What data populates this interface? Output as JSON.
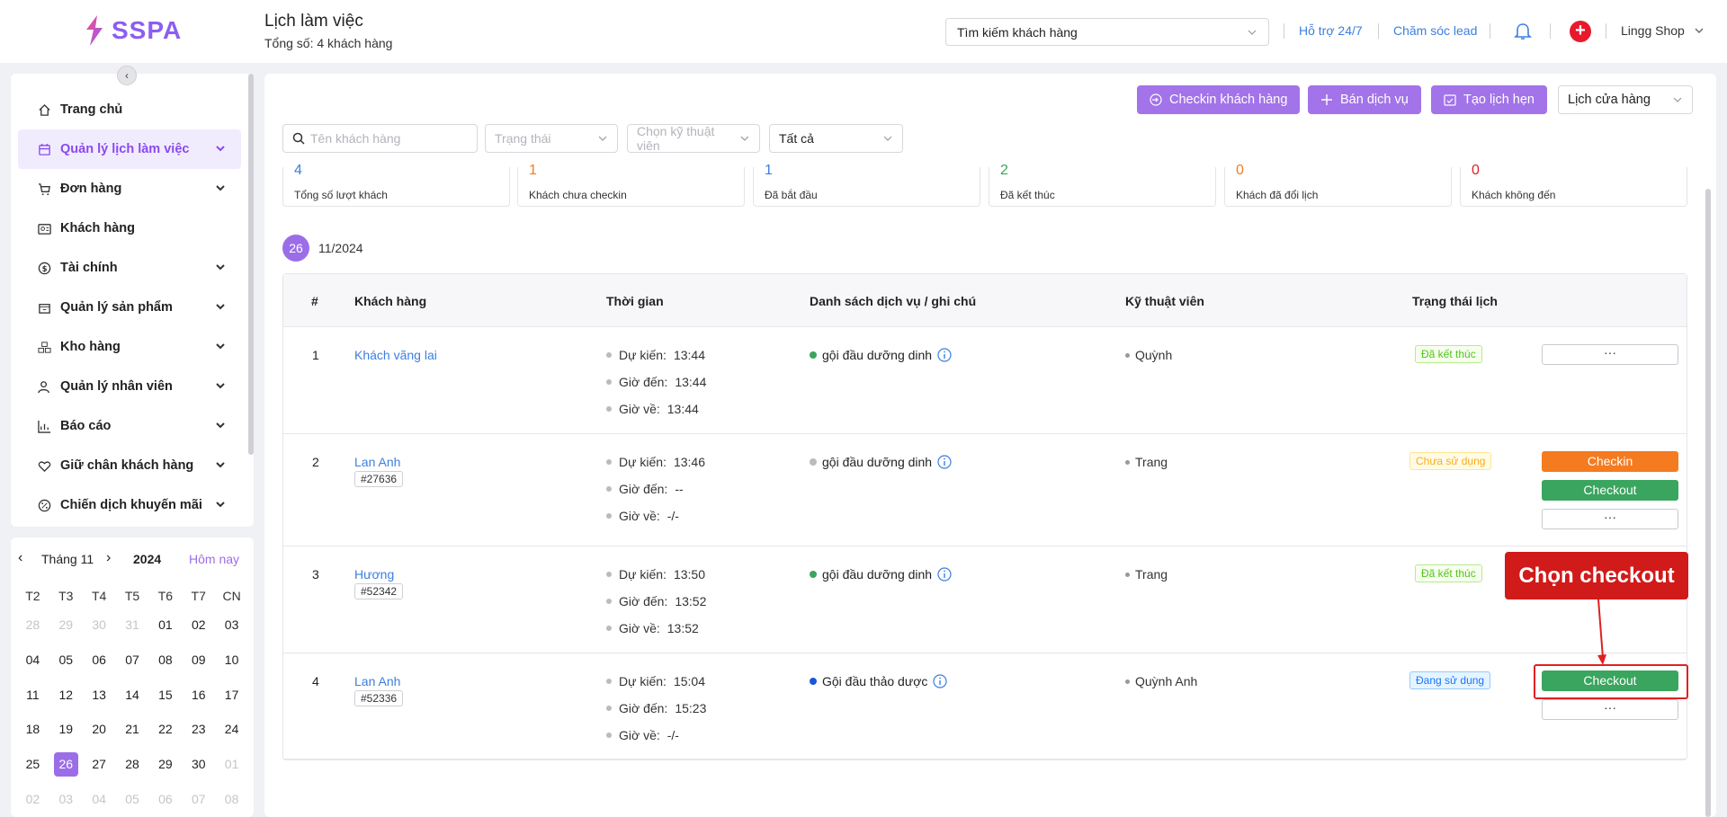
{
  "app": {
    "logo_text": "SSPA",
    "brand_color": "#8c5df2"
  },
  "header": {
    "title": "Lịch làm việc",
    "subtitle": "Tổng số: 4 khách hàng",
    "search_placeholder": "Tìm kiếm khách hàng",
    "support_link": "Hỗ trợ 24/7",
    "lead_link": "Chăm sóc lead",
    "shop_name": "Lingg Shop"
  },
  "sidebar": {
    "items": [
      {
        "label": "Trang chủ",
        "icon": "home-icon"
      },
      {
        "label": "Quản lý lịch làm việc",
        "icon": "calendar-icon"
      },
      {
        "label": "Đơn hàng",
        "icon": "cart-icon"
      },
      {
        "label": "Khách hàng",
        "icon": "id-card-icon"
      },
      {
        "label": "Tài chính",
        "icon": "dollar-icon"
      },
      {
        "label": "Quản lý sản phẩm",
        "icon": "box-icon"
      },
      {
        "label": "Kho hàng",
        "icon": "warehouse-icon"
      },
      {
        "label": "Quản lý nhân viên",
        "icon": "users-icon"
      },
      {
        "label": "Báo cáo",
        "icon": "chart-icon"
      },
      {
        "label": "Giữ chân khách hàng",
        "icon": "heart-icon"
      },
      {
        "label": "Chiến dịch khuyến mãi",
        "icon": "percent-icon"
      }
    ]
  },
  "calendar": {
    "month": "Tháng 11",
    "year": "2024",
    "today": "Hôm nay",
    "weekdays": [
      "T2",
      "T3",
      "T4",
      "T5",
      "T6",
      "T7",
      "CN"
    ],
    "weeks": [
      [
        "28",
        "29",
        "30",
        "31",
        "01",
        "02",
        "03"
      ],
      [
        "04",
        "05",
        "06",
        "07",
        "08",
        "09",
        "10"
      ],
      [
        "11",
        "12",
        "13",
        "14",
        "15",
        "16",
        "17"
      ],
      [
        "18",
        "19",
        "20",
        "21",
        "22",
        "23",
        "24"
      ],
      [
        "25",
        "26",
        "27",
        "28",
        "29",
        "30",
        "01"
      ],
      [
        "02",
        "03",
        "04",
        "05",
        "06",
        "07",
        "08"
      ]
    ],
    "selected": "26"
  },
  "toolbar": {
    "checkin_customer": "Checkin khách hàng",
    "sell_service": "Bán dịch vụ",
    "create_appointment": "Tạo lịch hẹn",
    "store_calendar": "Lịch cửa hàng"
  },
  "filters": {
    "name_placeholder": "Tên khách hàng",
    "status_placeholder": "Trạng thái",
    "tech_placeholder": "Chọn kỹ thuật viên",
    "all": "Tất cả"
  },
  "stats": [
    {
      "value": "4",
      "label": "Tổng số lượt khách",
      "color": "#3c7ee0"
    },
    {
      "value": "1",
      "label": "Khách chưa checkin",
      "color": "#f47b20"
    },
    {
      "value": "1",
      "label": "Đã bắt đầu",
      "color": "#3c7ee0"
    },
    {
      "value": "2",
      "label": "Đã kết thúc",
      "color": "#3aa55e"
    },
    {
      "value": "0",
      "label": "Khách đã đổi lịch",
      "color": "#f47b20"
    },
    {
      "value": "0",
      "label": "Khách không đến",
      "color": "#e02020"
    }
  ],
  "date_group": {
    "day": "26",
    "month_year": "11/2024"
  },
  "table": {
    "headers": [
      "#",
      "Khách hàng",
      "Thời gian",
      "Danh sách dịch vụ / ghi chú",
      "Kỹ thuật viên",
      "Trạng thái lịch"
    ],
    "time_labels": {
      "planned": "Dự kiến:",
      "arrive": "Giờ đến:",
      "leave": "Giờ về:"
    },
    "rows": [
      {
        "index": "1",
        "customer": "Khách vãng lai",
        "code": "",
        "planned": "13:44",
        "arrive": "13:44",
        "leave": "13:44",
        "service": "gội đầu dưỡng dinh",
        "service_dot": "#3aa55e",
        "tech": "Quỳnh",
        "status": "Đã kết thúc",
        "status_type": "done",
        "actions": [
          "···"
        ]
      },
      {
        "index": "2",
        "customer": "Lan Anh",
        "code": "#27636",
        "planned": "13:46",
        "arrive": "--",
        "leave": "-/-",
        "service": "gội đầu dưỡng dinh",
        "service_dot": "#bbbbbb",
        "tech": "Trang",
        "status": "Chưa sử dụng",
        "status_type": "unused",
        "actions": [
          "Checkin",
          "Checkout",
          "···"
        ]
      },
      {
        "index": "3",
        "customer": "Hương",
        "code": "#52342",
        "planned": "13:50",
        "arrive": "13:52",
        "leave": "13:52",
        "service": "gội đầu dưỡng dinh",
        "service_dot": "#3aa55e",
        "tech": "Trang",
        "status": "Đã kết thúc",
        "status_type": "done",
        "actions": []
      },
      {
        "index": "4",
        "customer": "Lan Anh",
        "code": "#52336",
        "planned": "15:04",
        "arrive": "15:23",
        "leave": "-/-",
        "service": "Gội đầu thảo dược",
        "service_dot": "#1a56db",
        "tech": "Quỳnh Anh",
        "status": "Đang sử dụng",
        "status_type": "using",
        "actions": [
          "Checkout",
          "···"
        ]
      }
    ]
  },
  "annotation": {
    "callout": "Chọn checkout"
  }
}
